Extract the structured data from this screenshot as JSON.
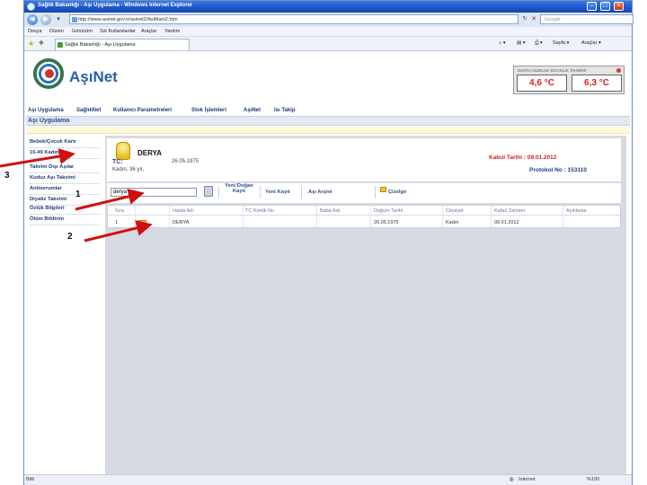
{
  "window": {
    "title": "Sağlık Bakanlığı - Aşı Uygulama - Windows Internet Explorer"
  },
  "address_bar": {
    "url": "http://www.asinet.gov.tr/asinet2/AsiMain2.htm",
    "search_placeholder": "Google"
  },
  "menu": [
    "Dosya",
    "Düzen",
    "Görünüm",
    "Sık Kullanılanlar",
    "Araçlar",
    "Yardım"
  ],
  "tab": {
    "label": "Sağlık Bakanlığı - Aşı Uygulama"
  },
  "commands": {
    "page": "Sayfa",
    "tools": "Araçlar"
  },
  "header": {
    "brand": "AşıNet",
    "weather_caption": "DUNYA GUNLUK SICAKLIK TAHMİNİ",
    "temp_low": "4,6 °C",
    "temp_high": "6,3 °C"
  },
  "top_nav": [
    "Aşı Uygulama",
    "SağlıkNet",
    "Kullanıcı Parametreleri",
    "Stok İşlemleri",
    "AşıNet",
    "Isı Takip"
  ],
  "section_title": "Aşı Uygulama",
  "sidebar": [
    "Bebek/Çocuk Kartı",
    "15-49 Kadın Aşı",
    "Takvim Dışı Aşılar",
    "Kuduz Aşı Takvimi",
    "Antiserumlar",
    "Diyaliz Takvimi",
    "Özlük Bilgileri",
    "Ölüm Bildirim"
  ],
  "patient": {
    "name": "DERYA",
    "tc_label": "TC:",
    "dob": "26.05.1975",
    "desc": "Kadın, 36 yıl,",
    "kabul": "Kabul Tarihi : 09.01.2012",
    "protokol": "Protokol No : 153110"
  },
  "toolbar": {
    "search_value": "derya",
    "new_arrival": "Yeni Doğan Kayıt",
    "new_record": "Yeni Kayıt",
    "vaccine_archive": "Aşı Arşivi",
    "schedule": "Çizelge"
  },
  "table": {
    "headers": [
      "Sıra",
      "",
      "Hasta Adı",
      "TC Kimlik No",
      "Baba Adı",
      "Doğum Tarihi",
      "Cinsiyet",
      "Kabul Zamanı",
      "Açıklama"
    ],
    "rows": [
      [
        "1",
        "",
        "DERYA",
        "",
        "",
        "26.05.1975",
        "Kadın",
        "09.01.2012",
        ""
      ]
    ]
  },
  "status_bar": {
    "left": "Bitti",
    "zone": "Internet",
    "zoom": "%100"
  },
  "annotations": {
    "label_1": "1",
    "label_2": "2",
    "label_3": "3",
    "arrow_color": "#d01010"
  }
}
